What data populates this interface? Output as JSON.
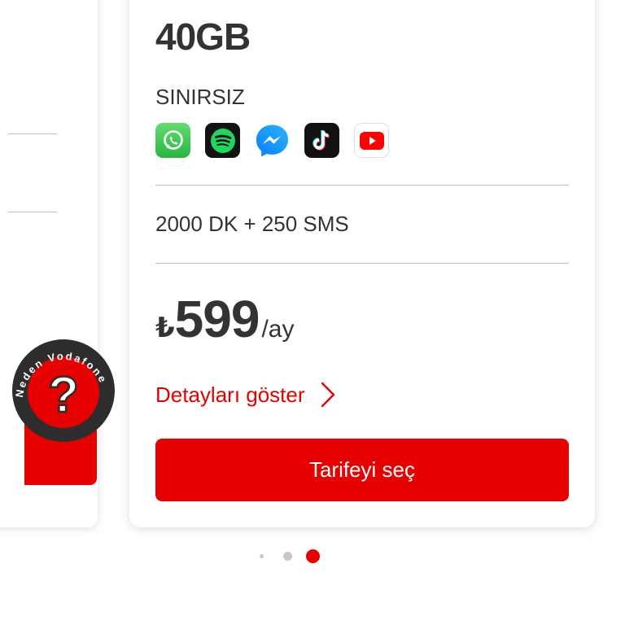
{
  "plan": {
    "data_amount": "40GB",
    "unlimited_label": "SINIRSIZ",
    "apps": [
      "whatsapp-icon",
      "spotify-icon",
      "messenger-icon",
      "tiktok-icon",
      "youtube-icon"
    ],
    "minutes_sms": "2000 DK + 250 SMS",
    "currency_symbol": "₺",
    "price": "599",
    "period": "/ay",
    "details_label": "Detayları göster",
    "select_label": "Tarifeyi seç"
  },
  "badge": {
    "text": "Neden Vodafone",
    "symbol": "?"
  },
  "pagination": {
    "count": 3,
    "active_index": 2
  },
  "colors": {
    "accent": "#e60000",
    "text": "#333333",
    "divider": "#bdbdbd"
  }
}
